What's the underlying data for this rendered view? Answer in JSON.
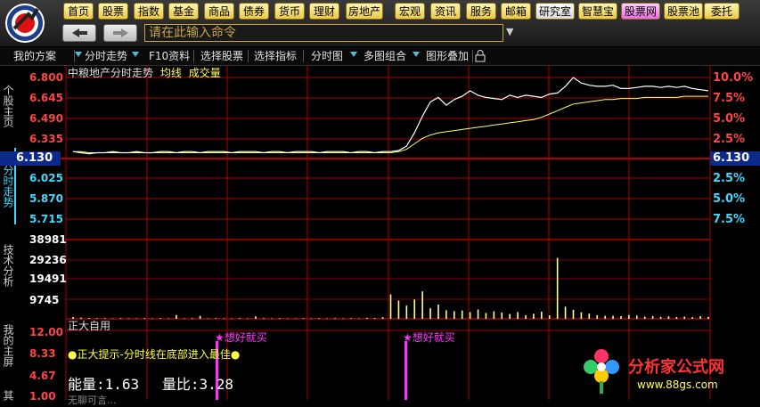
{
  "nav": {
    "buttons": [
      {
        "label": "首页",
        "style": "gold"
      },
      {
        "label": "股票",
        "style": "gold"
      },
      {
        "label": "指数",
        "style": "gold"
      },
      {
        "label": "基金",
        "style": "gold"
      },
      {
        "label": "商品",
        "style": "gold"
      },
      {
        "label": "债券",
        "style": "gold"
      },
      {
        "label": "货币",
        "style": "gold"
      },
      {
        "label": "理财",
        "style": "gold"
      },
      {
        "label": "房地产",
        "style": "gold"
      },
      {
        "label": "宏观",
        "style": "gold"
      },
      {
        "label": "资讯",
        "style": "gold"
      },
      {
        "label": "服务",
        "style": "gold"
      },
      {
        "label": "邮箱",
        "style": "gold"
      },
      {
        "label": "研究室",
        "style": "light"
      },
      {
        "label": "智慧宝",
        "style": "gold"
      },
      {
        "label": "股票网",
        "style": "pink"
      },
      {
        "label": "股票池",
        "style": "gold"
      },
      {
        "label": "委托",
        "style": "gold"
      }
    ],
    "back_icon": "back-arrow-icon",
    "forward_icon": "forward-arrow-icon",
    "command_placeholder": "请在此输入命令"
  },
  "toolbar": {
    "items": [
      "我的方案",
      "分时走势",
      "F10资料",
      "选择股票",
      "选择指标",
      "分时图",
      "多图组合",
      "图形叠加"
    ],
    "lock_icon": "lock-icon"
  },
  "sidebar": {
    "tabs": [
      "个股主页",
      "分时走势",
      "技术分析",
      "我的主屏",
      "其"
    ]
  },
  "chart_header": {
    "title": "中粮地产分时走势",
    "avg_label": "均线",
    "vol_label": "成交量"
  },
  "indicator": {
    "name": "正大自用",
    "tip": "正大提示-分时线在底部进入最佳",
    "signal_label": "想好就买",
    "energy_label": "能量:",
    "energy_value": "1.63",
    "ratio_label": "量比:",
    "ratio_value": "3.28",
    "axis_labels": [
      "12.00",
      "8.33",
      "4.67",
      "1.00"
    ],
    "bottom_text": "无聊可言..."
  },
  "watermark": {
    "name": "分析家公式网",
    "url": "www.88gs.com"
  },
  "colors": {
    "price_line": "#ffffff",
    "avg_line": "#ffff66",
    "grid_red": "#b00000",
    "up_label": "#ff4444",
    "down_label": "#40d8ff",
    "volume_bar": "#ffff99",
    "signal": "#ff33ff"
  },
  "chart_data": {
    "type": "line",
    "prev_close": 6.13,
    "price_ticks_up": [
      "6.800",
      "6.645",
      "6.490",
      "6.335"
    ],
    "price_tick_base": "6.130",
    "price_ticks_down": [
      "6.025",
      "5.870",
      "5.715"
    ],
    "pct_ticks_up": [
      "10.0%",
      "7.5%",
      "5.0%",
      "2.5%"
    ],
    "pct_tick_base": "6.130",
    "pct_ticks_down": [
      "2.5%",
      "5.0%",
      "7.5%"
    ],
    "volume_ticks": [
      "38981",
      "29236",
      "19491",
      "9745"
    ],
    "ylim": [
      5.52,
      6.8
    ],
    "price": [
      6.13,
      6.12,
      6.11,
      6.12,
      6.12,
      6.13,
      6.12,
      6.12,
      6.13,
      6.12,
      6.12,
      6.13,
      6.13,
      6.12,
      6.13,
      6.13,
      6.12,
      6.13,
      6.13,
      6.13,
      6.12,
      6.13,
      6.13,
      6.13,
      6.12,
      6.13,
      6.13,
      6.12,
      6.13,
      6.13,
      6.13,
      6.12,
      6.13,
      6.13,
      6.13,
      6.12,
      6.13,
      6.13,
      6.12,
      6.13,
      6.13,
      6.14,
      6.18,
      6.3,
      6.45,
      6.58,
      6.62,
      6.55,
      6.6,
      6.63,
      6.68,
      6.64,
      6.62,
      6.61,
      6.6,
      6.64,
      6.62,
      6.64,
      6.63,
      6.62,
      6.65,
      6.66,
      6.72,
      6.8,
      6.75,
      6.73,
      6.72,
      6.72,
      6.73,
      6.7,
      6.7,
      6.71,
      6.72,
      6.72,
      6.71,
      6.72,
      6.71,
      6.72,
      6.7,
      6.69,
      6.68
    ],
    "avg": [
      6.13,
      6.13,
      6.12,
      6.12,
      6.12,
      6.12,
      6.12,
      6.12,
      6.12,
      6.12,
      6.12,
      6.12,
      6.12,
      6.12,
      6.12,
      6.12,
      6.12,
      6.12,
      6.12,
      6.12,
      6.12,
      6.12,
      6.12,
      6.12,
      6.12,
      6.12,
      6.12,
      6.12,
      6.12,
      6.12,
      6.12,
      6.12,
      6.12,
      6.12,
      6.12,
      6.12,
      6.12,
      6.12,
      6.12,
      6.12,
      6.12,
      6.13,
      6.15,
      6.2,
      6.25,
      6.28,
      6.3,
      6.31,
      6.32,
      6.33,
      6.34,
      6.35,
      6.36,
      6.37,
      6.38,
      6.39,
      6.4,
      6.41,
      6.42,
      6.44,
      6.47,
      6.5,
      6.53,
      6.56,
      6.57,
      6.58,
      6.59,
      6.6,
      6.6,
      6.61,
      6.61,
      6.61,
      6.62,
      6.62,
      6.62,
      6.62,
      6.62,
      6.63,
      6.63,
      6.63,
      6.63
    ],
    "volume": [
      900,
      600,
      400,
      300,
      300,
      200,
      300,
      200,
      200,
      300,
      200,
      300,
      200,
      1900,
      200,
      300,
      1500,
      200,
      300,
      200,
      200,
      300,
      200,
      1200,
      300,
      200,
      300,
      200,
      200,
      300,
      200,
      300,
      200,
      300,
      200,
      300,
      200,
      500,
      400,
      800,
      12000,
      9000,
      6500,
      9500,
      13500,
      5200,
      7000,
      4200,
      3800,
      4100,
      3300,
      4600,
      2900,
      3700,
      3100,
      2400,
      3300,
      1800,
      2500,
      3500,
      1700,
      30000,
      6000,
      4500,
      3200,
      2600,
      1800,
      1500,
      1500,
      1300,
      1900,
      1600,
      1100,
      1400,
      1000,
      1200,
      900,
      1100,
      800,
      1300,
      1000
    ],
    "signals_at": [
      13,
      36
    ]
  }
}
